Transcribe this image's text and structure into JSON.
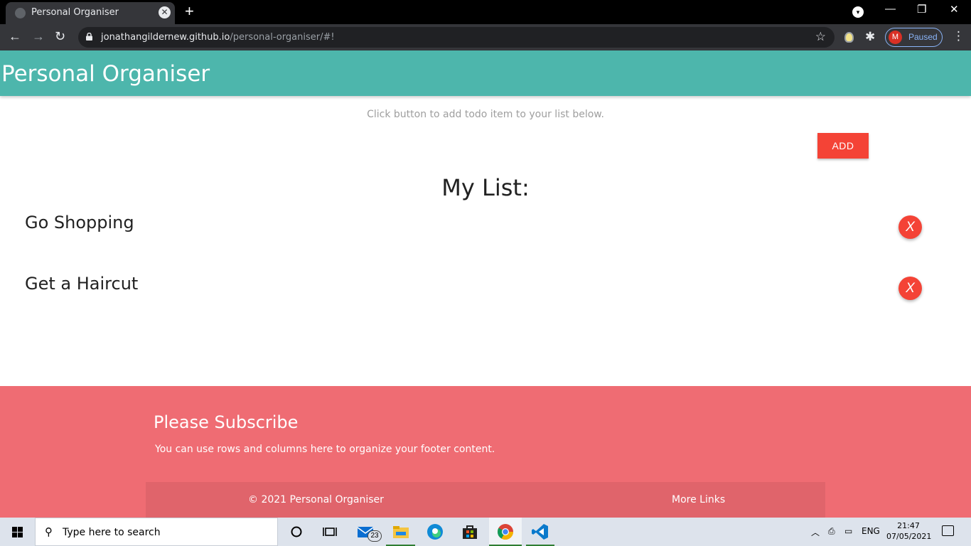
{
  "browser": {
    "tab_title": "Personal Organiser",
    "tab_close": "✕",
    "new_tab": "+",
    "url_host": "jonathangildernew.github.io",
    "url_path": "/personal-organiser/#!",
    "profile_initial": "M",
    "profile_status": "Paused",
    "colors": {
      "tabstrip": "#000000",
      "toolbar": "#35363a",
      "omnibox": "#202124"
    }
  },
  "header": {
    "title": "Personal Organiser",
    "color": "#4db6ac"
  },
  "main": {
    "hint": "Click button to add todo item to your list below.",
    "add_label": "ADD",
    "list_title": "My List:",
    "items": [
      {
        "text": "Go Shopping",
        "delete_label": "X"
      },
      {
        "text": "Get a Haircut",
        "delete_label": "X"
      }
    ],
    "accent": "#f44336"
  },
  "footer": {
    "heading": "Please Subscribe",
    "text": "You can use rows and columns here to organize your footer content.",
    "copyright": "© 2021 Personal Organiser",
    "more_links": "More Links",
    "color": "#ef6c73"
  },
  "taskbar": {
    "search_placeholder": "Type here to search",
    "mail_count": "23",
    "language": "ENG",
    "time": "21:47",
    "date": "07/05/2021"
  }
}
